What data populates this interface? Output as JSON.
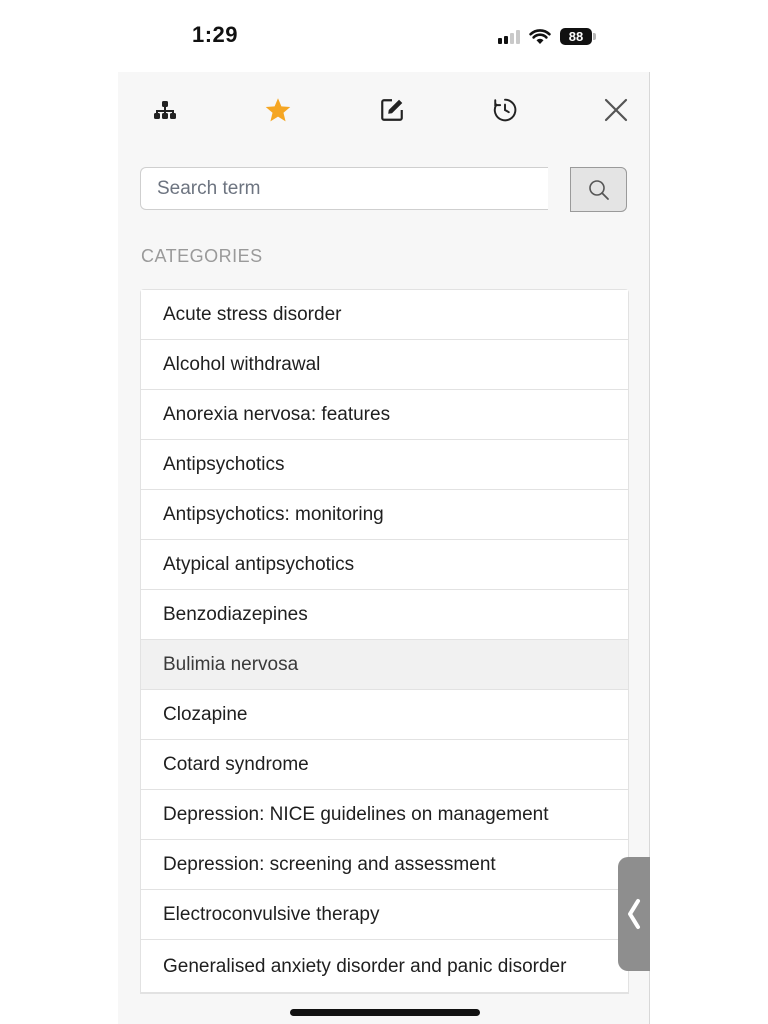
{
  "status_bar": {
    "time": "1:29",
    "battery": "88",
    "icons": [
      "signal-icon",
      "wifi-icon",
      "battery-icon"
    ]
  },
  "toolbar": {
    "icons": [
      "sitemap-icon",
      "star-icon",
      "edit-icon",
      "history-icon",
      "close-icon"
    ],
    "accent_color": "#f5a623"
  },
  "search": {
    "placeholder": "Search term",
    "value": ""
  },
  "categories": {
    "heading": "CATEGORIES",
    "items": [
      {
        "label": "Acute stress disorder"
      },
      {
        "label": "Alcohol withdrawal"
      },
      {
        "label": "Anorexia nervosa: features"
      },
      {
        "label": "Antipsychotics"
      },
      {
        "label": "Antipsychotics: monitoring"
      },
      {
        "label": "Atypical antipsychotics"
      },
      {
        "label": "Benzodiazepines"
      },
      {
        "label": "Bulimia nervosa"
      },
      {
        "label": "Clozapine"
      },
      {
        "label": "Cotard syndrome"
      },
      {
        "label": "Depression: NICE guidelines on management"
      },
      {
        "label": "Depression: screening and assessment"
      },
      {
        "label": "Electroconvulsive therapy"
      },
      {
        "label": "Generalised anxiety disorder and panic disorder"
      }
    ]
  },
  "side_handle": {
    "icon": "chevron-left-icon"
  }
}
